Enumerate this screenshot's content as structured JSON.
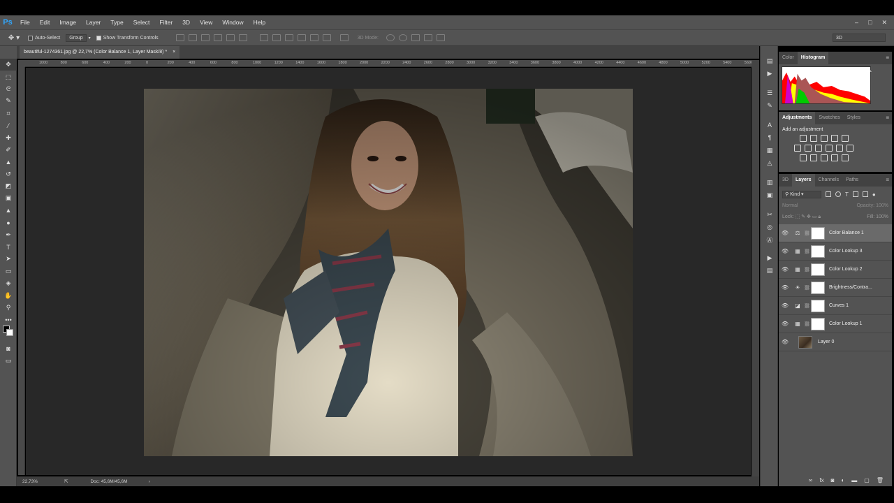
{
  "app": {
    "logo": "Ps"
  },
  "menu": [
    "File",
    "Edit",
    "Image",
    "Layer",
    "Type",
    "Select",
    "Filter",
    "3D",
    "View",
    "Window",
    "Help"
  ],
  "window_controls": [
    "–",
    "□",
    "✕"
  ],
  "options": {
    "auto_select_label": "Auto-Select",
    "group_value": "Group",
    "show_transform_label": "Show Transform Controls",
    "mode_3d_label": "3D Mode:",
    "workspace": "3D"
  },
  "document": {
    "tab_title": "beautiful-1274361.jpg @ 22,7% (Color Balance 1, Layer Mask/8) *",
    "tab_close": "×",
    "zoom": "22,73%",
    "doc_info": "Doc: 45,6M/45,6M",
    "ruler_labels": [
      "1000",
      "800",
      "600",
      "400",
      "200",
      "0",
      "200",
      "400",
      "600",
      "800",
      "1000",
      "1200",
      "1400",
      "1600",
      "1800",
      "2000",
      "2200",
      "2400",
      "2600",
      "2800",
      "3000",
      "3200",
      "3400",
      "3600",
      "3800",
      "4000",
      "4200",
      "4400",
      "4600",
      "4800",
      "5000",
      "5200",
      "5400",
      "5600"
    ]
  },
  "panels": {
    "color_tabs": [
      "Color",
      "Histogram"
    ],
    "adjust_tabs": [
      "Adjustments",
      "Swatches",
      "Styles"
    ],
    "add_adjustment": "Add an adjustment",
    "layer_tabs": [
      "3D",
      "Layers",
      "Channels",
      "Paths"
    ],
    "kind_label": "Kind",
    "blend_mode": "Normal",
    "opacity_label": "Opacity:",
    "opacity_value": "100%",
    "lock_label": "Lock:",
    "fill_label": "Fill:",
    "fill_value": "100%"
  },
  "layers": [
    {
      "name": "Color Balance 1",
      "icon": "color-balance-icon",
      "selected": true
    },
    {
      "name": "Color Lookup 3",
      "icon": "color-lookup-icon",
      "selected": false
    },
    {
      "name": "Color Lookup 2",
      "icon": "color-lookup-icon",
      "selected": false
    },
    {
      "name": "Brightness/Contra...",
      "icon": "brightness-icon",
      "selected": false
    },
    {
      "name": "Curves 1",
      "icon": "curves-icon",
      "selected": false
    },
    {
      "name": "Color Lookup 1",
      "icon": "color-lookup-icon",
      "selected": false
    },
    {
      "name": "Layer 0",
      "icon": "image-thumbnail",
      "selected": false
    }
  ],
  "colors": {
    "ps_blue": "#31a8ff",
    "ui_gray": "#535353",
    "canvas": "#282828"
  }
}
